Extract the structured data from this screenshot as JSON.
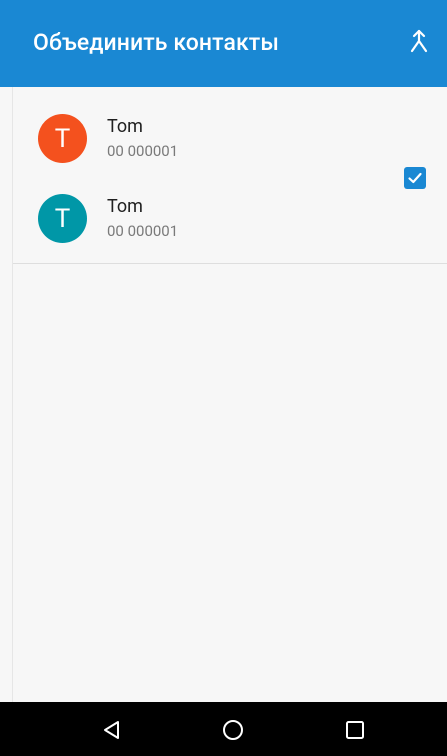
{
  "appbar": {
    "title": "Объединить контакты",
    "background": "#1a88d3"
  },
  "contacts": [
    {
      "initial": "T",
      "name": "Tom",
      "phone": "00 000001",
      "color": "#f4511e"
    },
    {
      "initial": "T",
      "name": "Tom",
      "phone": "00 000001",
      "color": "#0097a7"
    }
  ],
  "selection": {
    "checked": true
  },
  "navbar": {
    "buttons": [
      "back-icon",
      "home-icon",
      "recents-icon"
    ]
  }
}
